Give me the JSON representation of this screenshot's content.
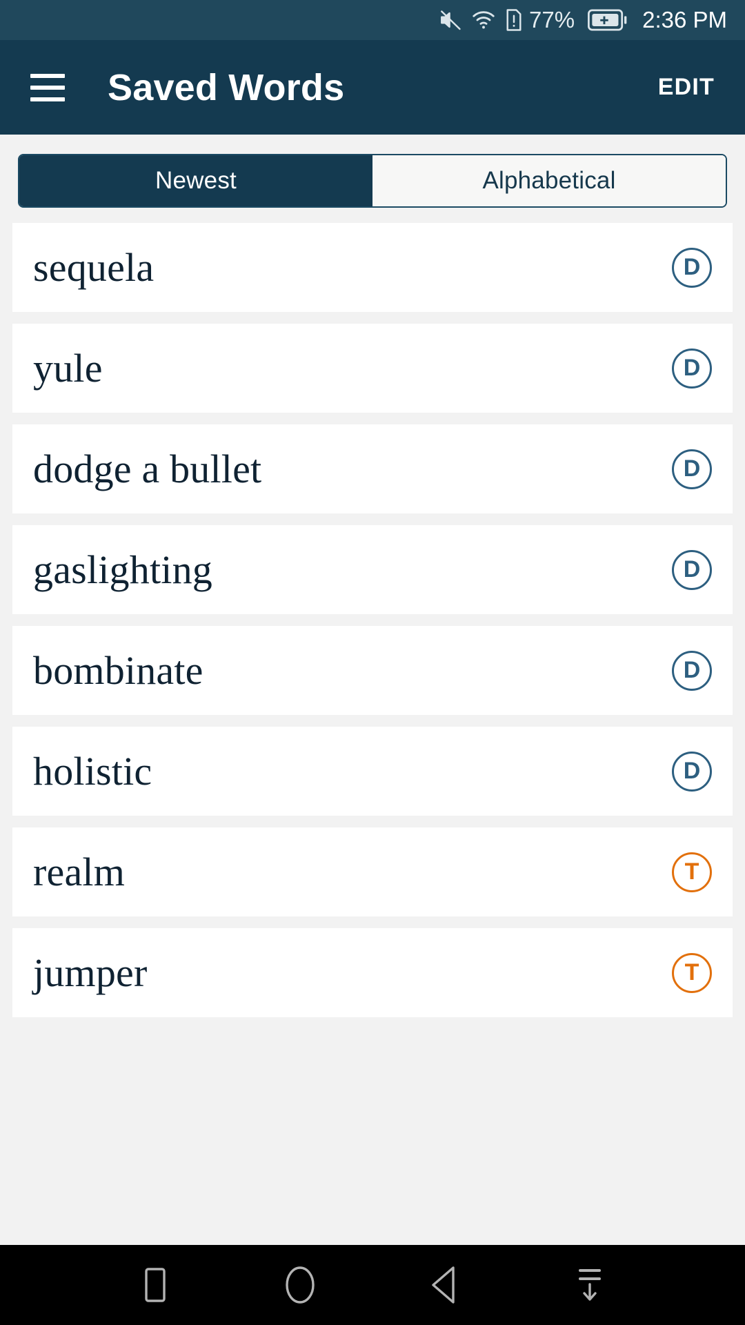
{
  "status_bar": {
    "icons": [
      "mute-icon",
      "wifi-icon",
      "sim-alert-icon",
      "battery-charging-icon"
    ],
    "battery_percent": "77%",
    "time": "2:36 PM"
  },
  "app_bar": {
    "menu_icon": "hamburger-menu-icon",
    "title": "Saved Words",
    "edit_label": "EDIT"
  },
  "segmented_control": {
    "tabs": [
      {
        "label": "Newest",
        "active": true
      },
      {
        "label": "Alphabetical",
        "active": false
      }
    ]
  },
  "word_list": {
    "items": [
      {
        "word": "sequela",
        "badge": "D",
        "badge_type": "dictionary"
      },
      {
        "word": "yule",
        "badge": "D",
        "badge_type": "dictionary"
      },
      {
        "word": "dodge a bullet",
        "badge": "D",
        "badge_type": "dictionary"
      },
      {
        "word": "gaslighting",
        "badge": "D",
        "badge_type": "dictionary"
      },
      {
        "word": "bombinate",
        "badge": "D",
        "badge_type": "dictionary"
      },
      {
        "word": "holistic",
        "badge": "D",
        "badge_type": "dictionary"
      },
      {
        "word": "realm",
        "badge": "T",
        "badge_type": "thesaurus"
      },
      {
        "word": "jumper",
        "badge": "T",
        "badge_type": "thesaurus"
      }
    ]
  },
  "nav_bar": {
    "buttons": [
      {
        "icon": "recents-square-icon"
      },
      {
        "icon": "home-circle-icon"
      },
      {
        "icon": "back-triangle-icon"
      },
      {
        "icon": "hide-keyboard-icon"
      }
    ]
  },
  "colors": {
    "status_bar": "#20485c",
    "app_bar": "#143a50",
    "page_background": "#f2f2f2",
    "card": "#ffffff",
    "accent_navy": "#2d5f80",
    "accent_orange": "#e2700c",
    "nav_bar": "#000000"
  }
}
